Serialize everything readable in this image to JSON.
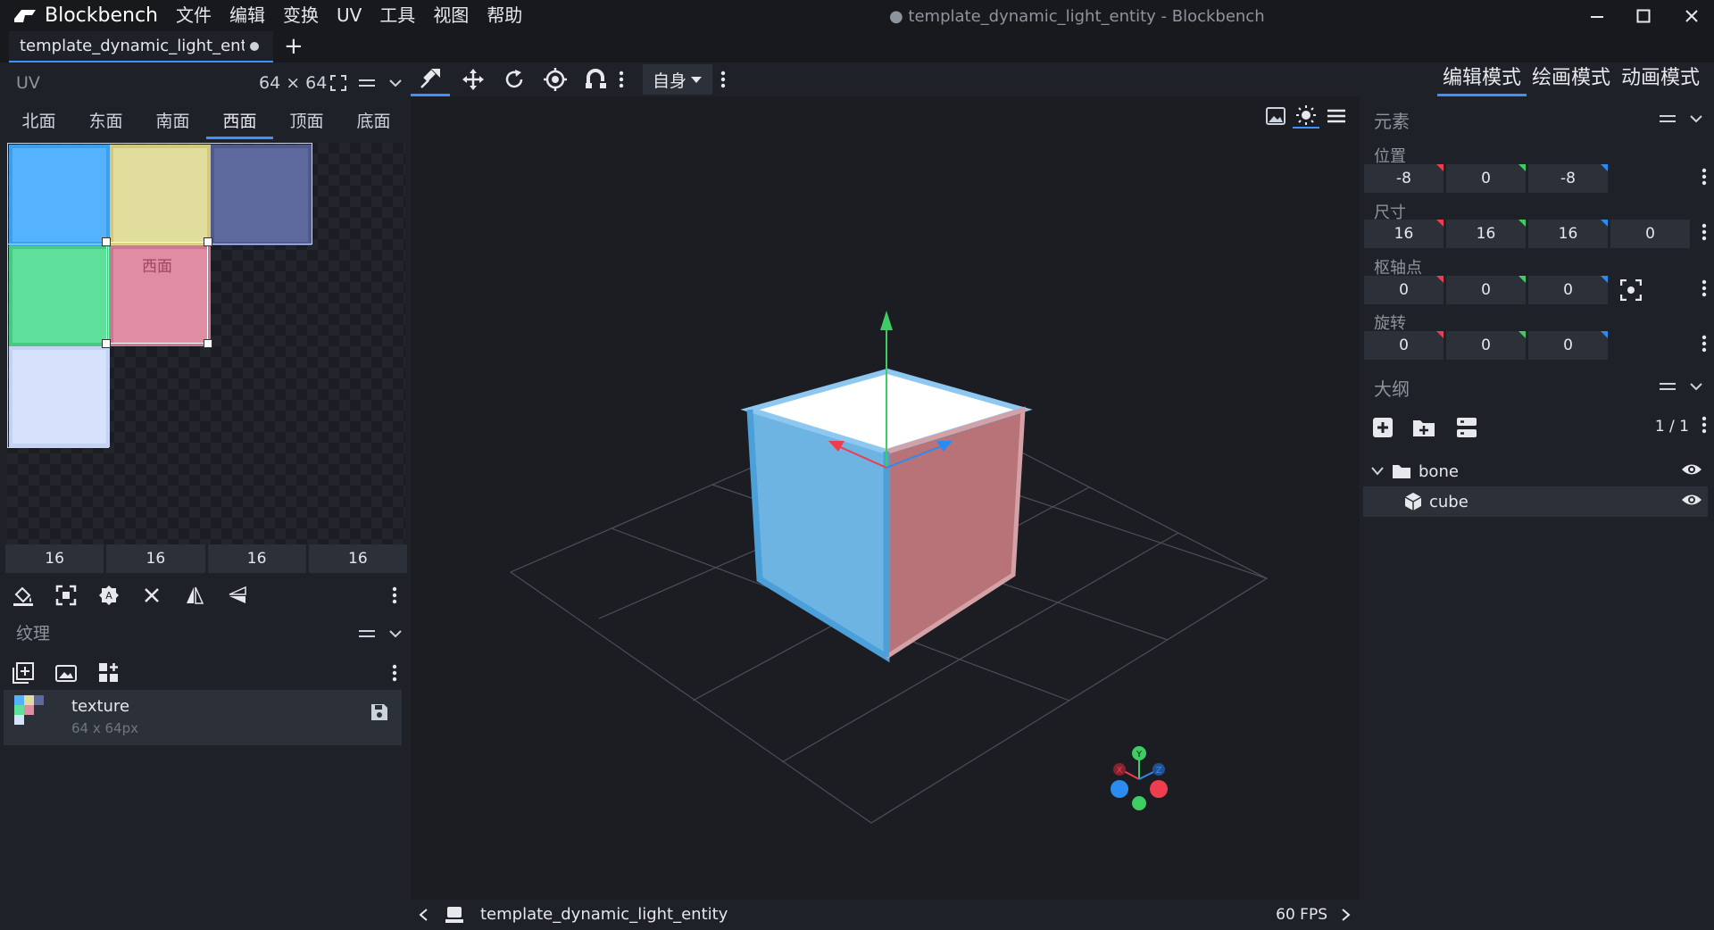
{
  "app": {
    "name": "Blockbench",
    "menu": [
      "文件",
      "编辑",
      "变换",
      "UV",
      "工具",
      "视图",
      "帮助"
    ],
    "window_title": "● template_dynamic_light_entity - Blockbench"
  },
  "tabs": [
    {
      "label": "template_dynamic_light_entit",
      "unsaved": true
    }
  ],
  "uv_panel": {
    "title": "UV",
    "size": "64 × 64",
    "faces": [
      "北面",
      "东面",
      "南面",
      "西面",
      "顶面",
      "底面"
    ],
    "active_face": "西面",
    "selected_face_label": "西面",
    "face_colors": [
      "#55b2ff",
      "#e1de9d",
      "#5e6a9e",
      "#5fe09a",
      "#e08ca3",
      "#d6e1fb"
    ],
    "values": [
      "16",
      "16",
      "16",
      "16"
    ]
  },
  "textures_panel": {
    "title": "纹理",
    "items": [
      {
        "name": "texture",
        "dims": "64 x 64px"
      }
    ]
  },
  "toolbar": {
    "space": "自身"
  },
  "modes": [
    {
      "label": "编辑模式",
      "active": true
    },
    {
      "label": "绘画模式",
      "active": false
    },
    {
      "label": "动画模式",
      "active": false
    }
  ],
  "element_panel": {
    "title": "元素",
    "position": {
      "label": "位置",
      "values": [
        "-8",
        "0",
        "-8"
      ]
    },
    "size": {
      "label": "尺寸",
      "values": [
        "16",
        "16",
        "16",
        "0"
      ]
    },
    "pivot": {
      "label": "枢轴点",
      "values": [
        "0",
        "0",
        "0"
      ]
    },
    "rotation": {
      "label": "旋转",
      "values": [
        "0",
        "0",
        "0"
      ]
    }
  },
  "outliner": {
    "title": "大纲",
    "count": "1 / 1",
    "items": [
      {
        "label": "bone",
        "type": "group"
      },
      {
        "label": "cube",
        "type": "cube"
      }
    ]
  },
  "status": {
    "title": "template_dynamic_light_entity",
    "fps": "60 FPS"
  },
  "gizmo_axes": [
    "Y",
    "X",
    "Z"
  ],
  "colors": {
    "accent": "#3e90ff",
    "axis_x": "#f03c4f",
    "axis_y": "#3fcd63",
    "axis_z": "#2c8bf0"
  }
}
